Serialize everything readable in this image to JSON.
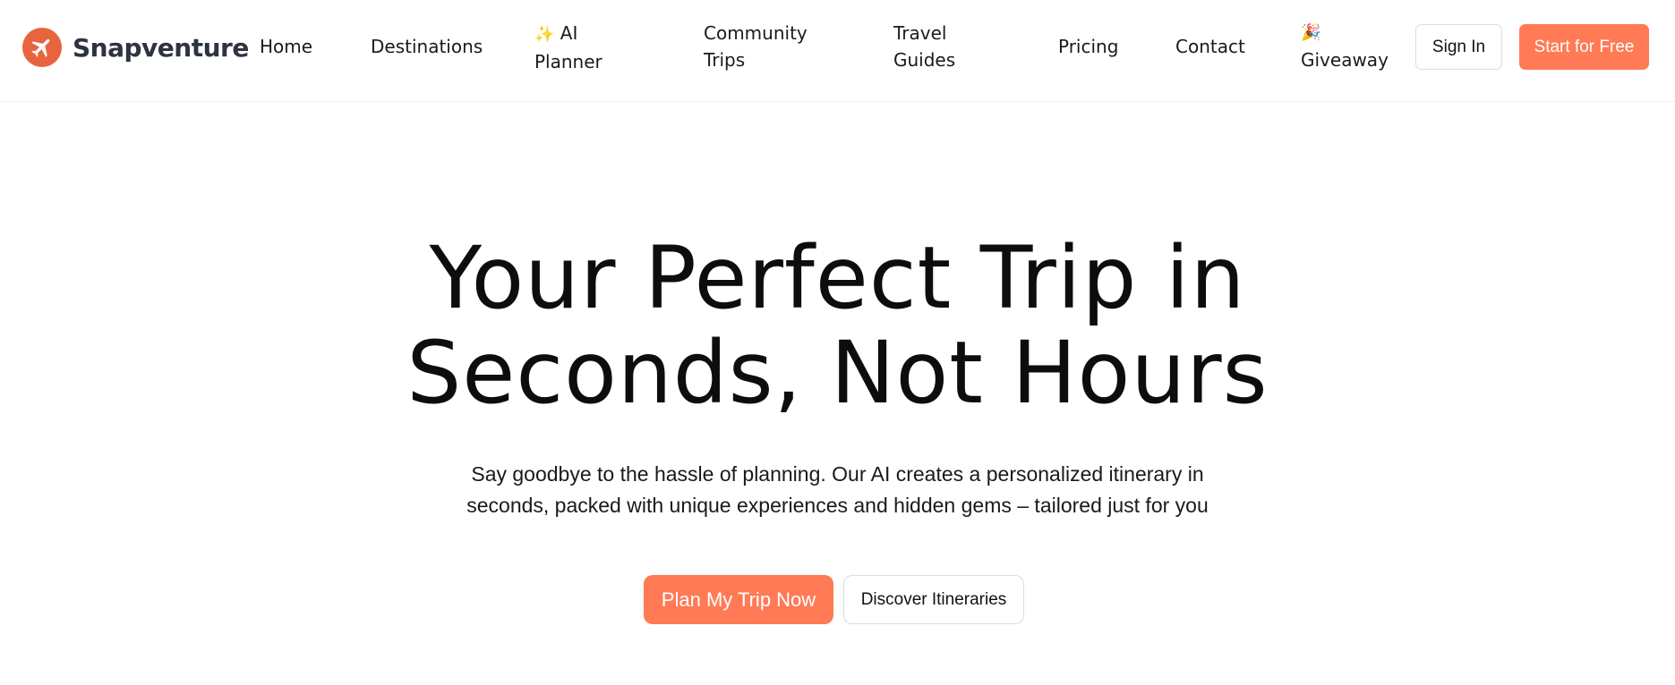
{
  "brand": {
    "name": "Snapventure",
    "logo_icon": "airplane-icon",
    "color": "#e8643f"
  },
  "nav": {
    "home": "Home",
    "destinations": "Destinations",
    "ai_planner_emoji": "✨",
    "ai_planner_line1": "AI",
    "ai_planner_line2": "Planner",
    "community_line1": "Community",
    "community_line2": "Trips",
    "guides_line1": "Travel",
    "guides_line2": "Guides",
    "pricing": "Pricing",
    "contact": "Contact",
    "giveaway_emoji": "🎉",
    "giveaway": "Giveaway"
  },
  "header_actions": {
    "sign_in": "Sign In",
    "start_free": "Start for Free"
  },
  "hero": {
    "title_line1": "Your Perfect Trip in",
    "title_line2": "Seconds, Not Hours",
    "subtitle_line1": "Say goodbye to the hassle of planning. Our AI creates a personalized itinerary in",
    "subtitle_line2": "seconds, packed with unique experiences and hidden gems – tailored just for you",
    "cta_primary": "Plan My Trip Now",
    "cta_secondary": "Discover Itineraries"
  },
  "colors": {
    "accent": "#ff7a55",
    "text": "#111111",
    "border": "#dcdcdc"
  }
}
